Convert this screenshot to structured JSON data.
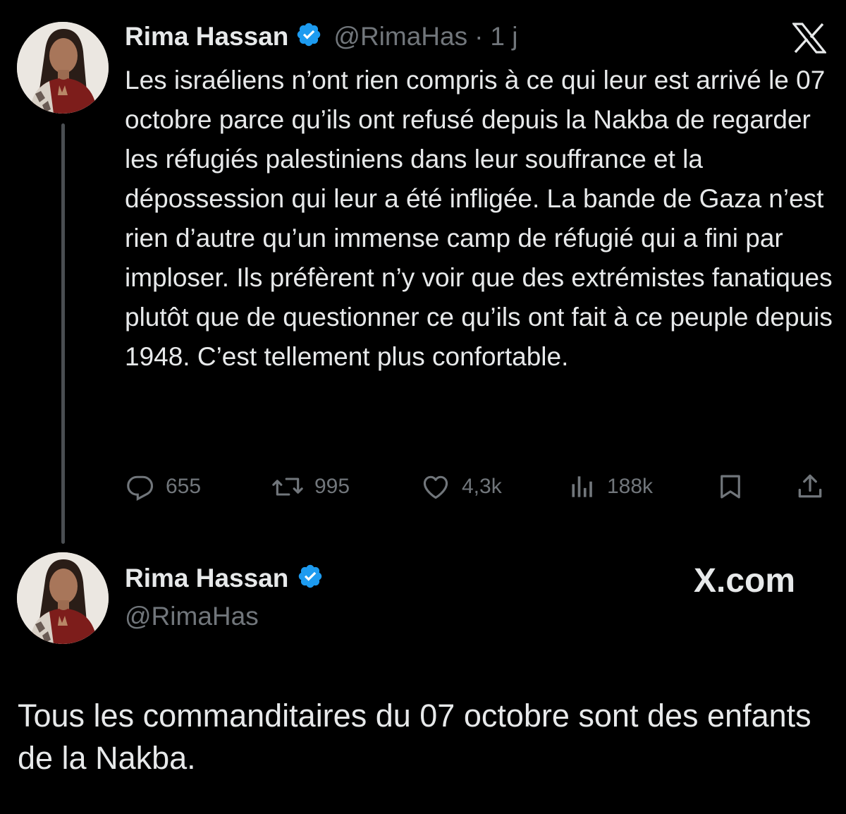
{
  "tweet": {
    "author_name": "Rima Hassan",
    "handle": "@RimaHas",
    "separator": "·",
    "time": "1 j",
    "text": "Les israéliens n’ont rien compris à ce qui leur est arrivé le 07 octobre parce qu’ils ont refusé depuis la Nakba de regarder les réfugiés palestiniens dans leur souffrance et la dépossession qui leur a été infligée. La bande de Gaza n’est rien d’autre qu’un immense camp de réfugié qui a fini par imploser. Ils préfèrent n’y voir que des extrémistes fanatiques plutôt que de questionner ce qu’ils ont fait à ce peuple depuis 1948. C’est tellement plus confortable.",
    "actions": {
      "replies": "655",
      "reposts": "995",
      "likes": "4,3k",
      "views": "188k"
    }
  },
  "quoted_tweet": {
    "author_name": "Rima Hassan",
    "handle": "@RimaHas",
    "site_label": "X.com",
    "text": "Tous les commanditaires du 07 octobre sont des enfants de la Nakba."
  },
  "colors": {
    "background": "#000000",
    "text": "#e7e9ea",
    "muted": "#71767b",
    "verified": "#1d9bf0",
    "thread_line": "#4a4e52"
  },
  "icons": [
    "verified-badge-icon",
    "x-logo-icon",
    "reply-icon",
    "repost-icon",
    "like-icon",
    "views-icon",
    "bookmark-icon",
    "share-icon"
  ]
}
